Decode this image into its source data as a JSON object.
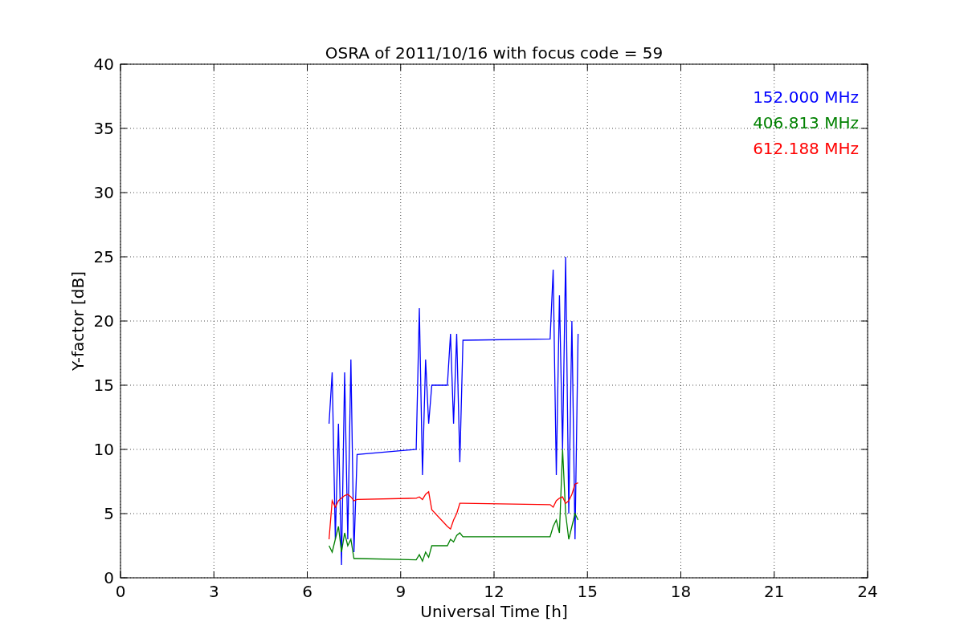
{
  "plot": {
    "chart_data": {
      "type": "line",
      "title": "OSRA of 2011/10/16 with focus code = 59",
      "xlabel": "Universal Time [h]",
      "ylabel": "Y-factor [dB]",
      "grid": true,
      "xlim": [
        0,
        24
      ],
      "ylim": [
        0,
        40
      ],
      "xticks": [
        0,
        3,
        6,
        9,
        12,
        15,
        18,
        21,
        24
      ],
      "yticks": [
        0,
        5,
        10,
        15,
        20,
        25,
        30,
        35,
        40
      ],
      "x": [
        6.7,
        6.8,
        6.9,
        7.0,
        7.1,
        7.2,
        7.3,
        7.4,
        7.5,
        7.6,
        9.5,
        9.6,
        9.7,
        9.8,
        9.9,
        10.0,
        10.5,
        10.6,
        10.7,
        10.8,
        10.9,
        11.0,
        13.8,
        13.9,
        14.0,
        14.1,
        14.2,
        14.3,
        14.4,
        14.5,
        14.6,
        14.7
      ],
      "series": [
        {
          "name": "152.000 MHz",
          "color": "#0000ff",
          "values": [
            12,
            16,
            3,
            12,
            1,
            16,
            3,
            17,
            2,
            9.6,
            10,
            21,
            8,
            17,
            12,
            15,
            15,
            19,
            12,
            19,
            9,
            18.5,
            18.6,
            24,
            8,
            22,
            10,
            25,
            5,
            20,
            3,
            19
          ]
        },
        {
          "name": "406.813 MHz",
          "color": "#008000",
          "values": [
            2.5,
            2,
            3,
            4,
            2,
            3.5,
            2.5,
            3,
            1.5,
            1.5,
            1.4,
            1.8,
            1.3,
            2,
            1.6,
            2.5,
            2.5,
            3,
            2.8,
            3.3,
            3.5,
            3.2,
            3.2,
            4,
            4.5,
            3.5,
            10,
            5,
            3,
            4,
            5,
            4.5
          ]
        },
        {
          "name": "612.188 MHz",
          "color": "#ff0000",
          "values": [
            3,
            6,
            5.5,
            6,
            6.2,
            6.4,
            6.5,
            6.3,
            6,
            6.1,
            6.2,
            6.3,
            6.1,
            6.5,
            6.7,
            5.3,
            4,
            3.8,
            4.5,
            5,
            5.8,
            5.8,
            5.7,
            5.5,
            6,
            6.2,
            6.3,
            5.8,
            6,
            6.5,
            7.3,
            7.4
          ]
        }
      ]
    }
  }
}
